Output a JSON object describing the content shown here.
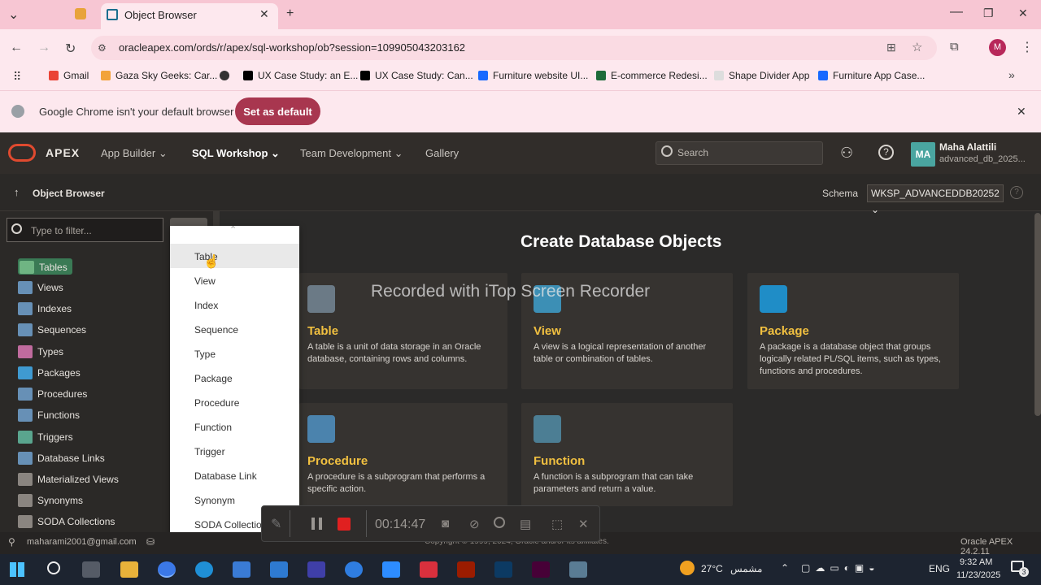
{
  "browser": {
    "tab_title": "Object Browser",
    "url": "oracleapex.com/ords/r/apex/sql-workshop/ob?session=109905043203162",
    "profile_initial": "M",
    "bookmarks": [
      {
        "label": "Gmail",
        "color": "#ea4335"
      },
      {
        "label": "Gaza Sky Geeks: Car...",
        "color": "#f2a33a"
      },
      {
        "label": "",
        "color": "#333333"
      },
      {
        "label": "UX Case Study: an E...",
        "color": "#000000"
      },
      {
        "label": "UX Case Study: Can...",
        "color": "#000000"
      },
      {
        "label": "Furniture website UI...",
        "color": "#1769ff"
      },
      {
        "label": "E-commerce Redesi...",
        "color": "#1d6b3a"
      },
      {
        "label": "Shape Divider App",
        "color": "#dddddd"
      },
      {
        "label": "Furniture App Case...",
        "color": "#1769ff"
      }
    ],
    "infobar_text": "Google Chrome isn't your default browser",
    "set_default_label": "Set as default"
  },
  "apex": {
    "brand": "APEX",
    "nav": [
      "App Builder",
      "SQL Workshop",
      "Team Development",
      "Gallery"
    ],
    "search_placeholder": "Search",
    "user_initials": "MA",
    "user_name": "Maha Alattili",
    "user_workspace": "advanced_db_2025...",
    "breadcrumb": "Object Browser",
    "schema_label": "Schema",
    "schema_value": "WKSP_ADVANCEDDB20252",
    "filter_placeholder": "Type to filter...",
    "object_types": [
      "Tables",
      "Views",
      "Indexes",
      "Sequences",
      "Types",
      "Packages",
      "Procedures",
      "Functions",
      "Triggers",
      "Database Links",
      "Materialized Views",
      "Synonyms",
      "SODA Collections"
    ],
    "create_menu": [
      "Table",
      "View",
      "Index",
      "Sequence",
      "Type",
      "Package",
      "Procedure",
      "Function",
      "Trigger",
      "Database Link",
      "Synonym",
      "SODA Collection"
    ],
    "main_title": "Create Database Objects",
    "cards": [
      {
        "title": "Table",
        "desc": "A table is a unit of data storage in an Oracle database, containing rows and columns."
      },
      {
        "title": "View",
        "desc": "A view is a logical representation of another table or combination of tables."
      },
      {
        "title": "Package",
        "desc": "A package is a database object that groups logically related PL/SQL items, such as types, functions and procedures."
      },
      {
        "title": "Procedure",
        "desc": "A procedure is a subprogram that performs a specific action."
      },
      {
        "title": "Function",
        "desc": "A function is a subprogram that can take parameters and return a value."
      }
    ],
    "footer_user": "maharami2001@gmail.com",
    "footer_copyright": "Copyright © 1999, 2024, Oracle and/or its affiliates.",
    "footer_version": "Oracle APEX 24.2.11"
  },
  "recorder": {
    "watermark": "Recorded with iTop Screen Recorder",
    "time": "00:14:47"
  },
  "taskbar": {
    "weather": "27°C",
    "weather_desc": "مشمس",
    "lang": "ENG",
    "time": "9:32 AM",
    "date": "11/23/2025",
    "notifications": "3"
  }
}
